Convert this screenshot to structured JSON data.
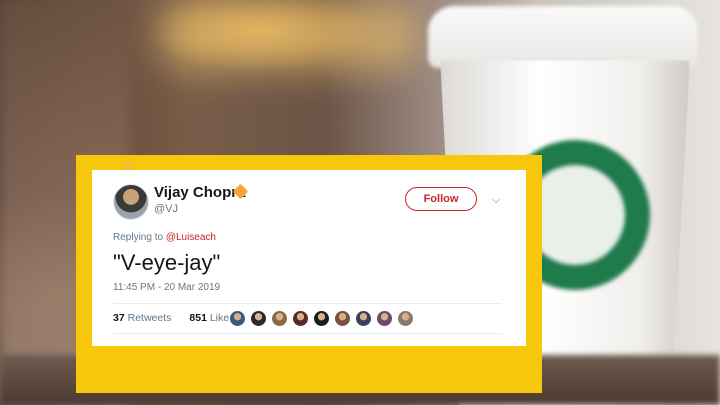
{
  "tweet": {
    "display_name": "Vijay Chopra",
    "handle": "@VJ",
    "follow_label": "Follow",
    "chevron_icon": "chevron-down-icon",
    "replying_prefix": "Replying to",
    "replying_to": "@Luiseach",
    "text": "\"V-eye-jay\"",
    "timestamp": "11:45 PM - 20 Mar 2019",
    "retweets_count": "37",
    "retweets_label": "Retweets",
    "likes_count": "851",
    "likes_label": "Likes",
    "liker_avatars": [
      "#3a5a7a",
      "#2b2b2b",
      "#8a6a45",
      "#5a2a2a",
      "#1d1d1d",
      "#7a5040",
      "#3a4060",
      "#6a4a6a",
      "#8a7a6a"
    ]
  },
  "colors": {
    "frame": "#f6c70a",
    "accent": "#c8242b",
    "verified": "#f7a531"
  }
}
